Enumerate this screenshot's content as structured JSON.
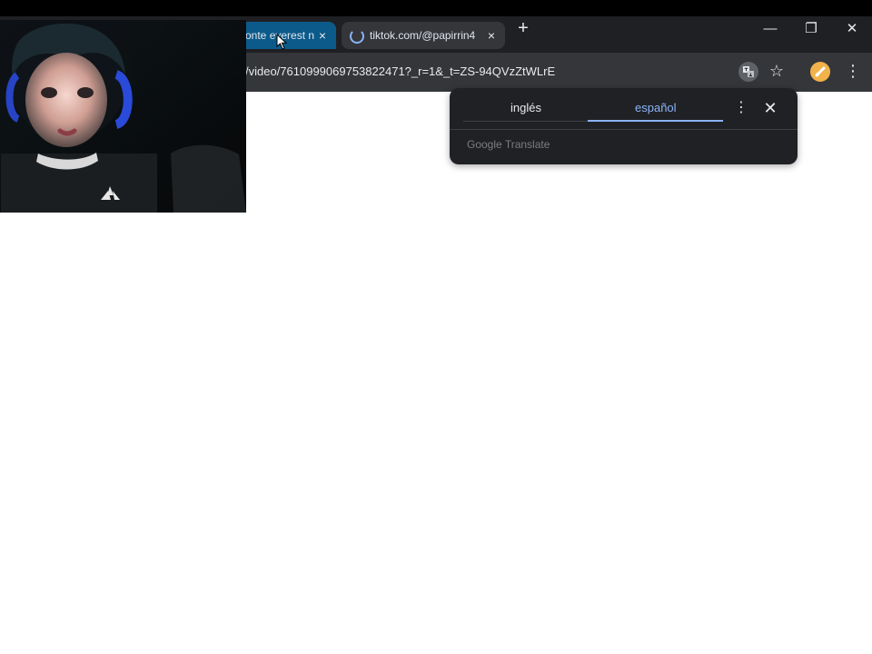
{
  "tabs": [
    {
      "title": "onte everest n",
      "active": true
    },
    {
      "title": "tiktok.com/@papirrin4",
      "active": false
    }
  ],
  "address_bar": {
    "url_text": "/video/7610999069753822471?_r=1&_t=ZS-94QVzZtWLrE"
  },
  "translate_popup": {
    "source_language": "inglés",
    "target_language": "español",
    "footer": "Google Translate"
  },
  "icons": {
    "tab_close": "×",
    "new_tab": "+",
    "minimize": "—",
    "restore": "❐",
    "close": "✕",
    "star": "☆",
    "more_vertical": "⋮",
    "popup_close": "✕"
  },
  "colors": {
    "tabbar": "#1f2023",
    "toolbar": "#35363a",
    "active_tab": "#0b5a8a",
    "accent": "#8ab4f8",
    "popup_bg": "#202124"
  }
}
